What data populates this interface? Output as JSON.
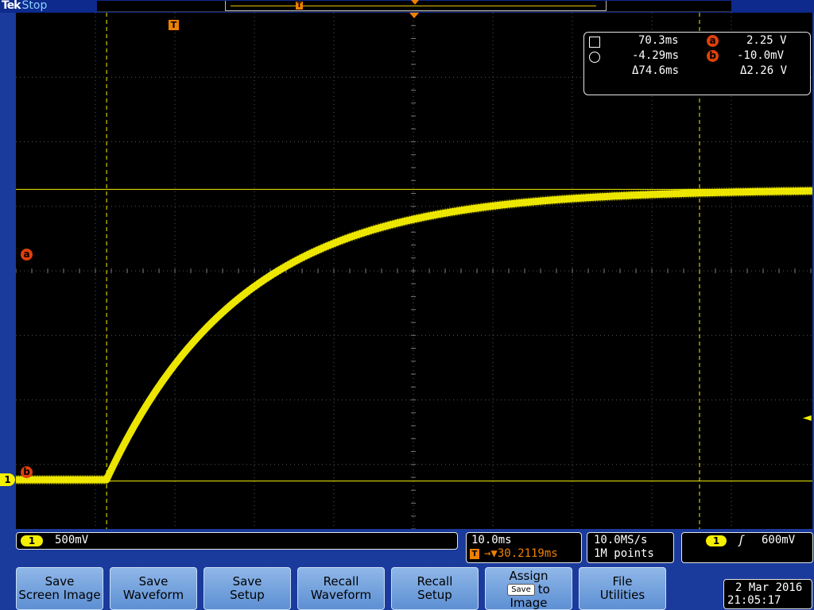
{
  "header": {
    "brand": "Tek",
    "run_state": "Stop",
    "record_trigger_marker": "T"
  },
  "trigger": {
    "position_marker": "T",
    "level_marker": "◄"
  },
  "cursors": {
    "a_label": "a",
    "b_label": "b",
    "time_cursor_1": "70.3ms",
    "time_cursor_2": "-4.29ms",
    "delta_time": "Δ74.6ms",
    "volt_cursor_a": "2.25 V",
    "volt_cursor_b": "-10.0mV",
    "delta_volt": "Δ2.26 V"
  },
  "channel": {
    "number": "1",
    "vertical_scale": "500mV",
    "color": "#f5ef00"
  },
  "timebase": {
    "scale": "10.0ms",
    "trigger_marker": "T",
    "delay": "→▼30.2119ms"
  },
  "acquisition": {
    "sample_rate": "10.0MS/s",
    "record_length": "1M points"
  },
  "trigger_status": {
    "source": "1",
    "slope": "ʃ",
    "level": "600mV"
  },
  "menu": {
    "save_screen_image": [
      "Save",
      "Screen Image"
    ],
    "save_waveform": [
      "Save",
      "Waveform"
    ],
    "save_setup": [
      "Save",
      "Setup"
    ],
    "recall_waveform": [
      "Recall",
      "Waveform"
    ],
    "recall_setup": [
      "Recall",
      "Setup"
    ],
    "assign": {
      "line1": "Assign",
      "key": "Save",
      "to": "to",
      "line3": "Image"
    },
    "file_utilities": [
      "File",
      "Utilities"
    ]
  },
  "datetime": {
    "date": "2 Mar 2016",
    "time": "21:05:17"
  },
  "waveform": {
    "baseline_volts": 0.0,
    "final_volts": 2.25,
    "rise_start_ms": -4.3,
    "time_constant_ms": 17.0,
    "ms_per_div": 10.0,
    "mv_per_div": 500
  }
}
